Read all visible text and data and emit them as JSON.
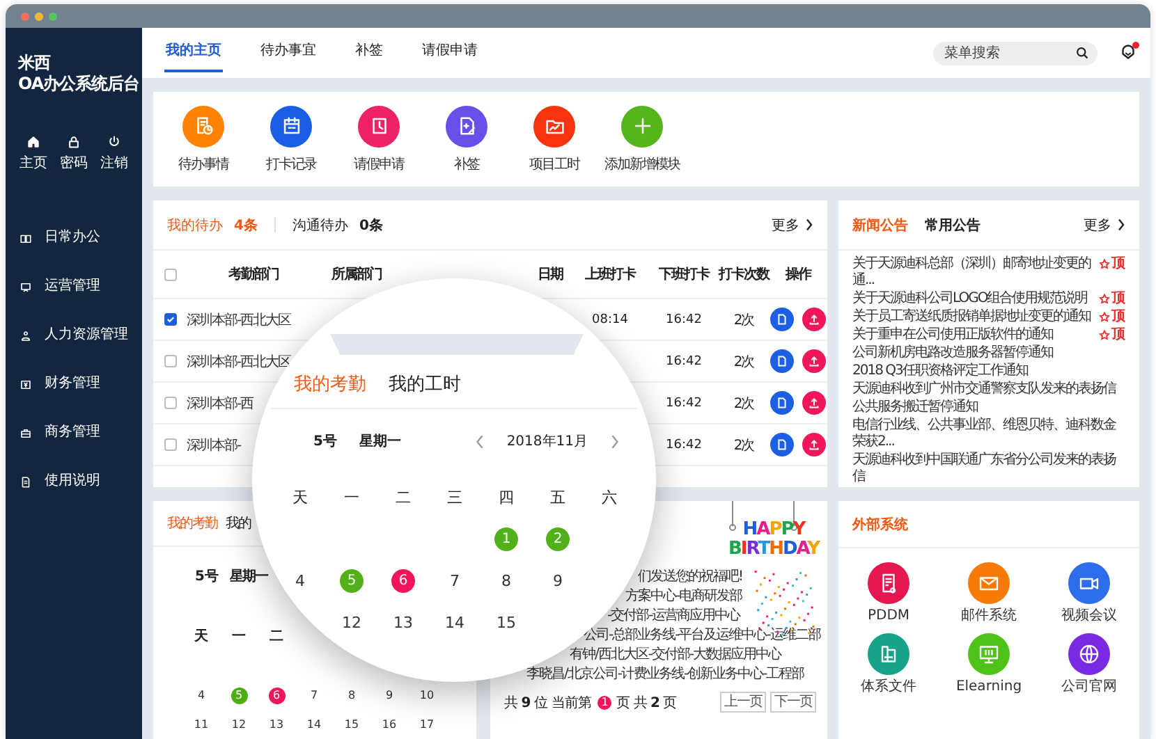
{
  "sidebar": {
    "title_lines": [
      "米西",
      "OA办公系统后台"
    ],
    "shortcuts": [
      {
        "label": "主页"
      },
      {
        "label": "密码"
      },
      {
        "label": "注销"
      }
    ],
    "menu": [
      {
        "label": "日常办公"
      },
      {
        "label": "运营管理"
      },
      {
        "label": "人力资源管理"
      },
      {
        "label": "财务管理"
      },
      {
        "label": "商务管理"
      },
      {
        "label": "使用说明"
      }
    ]
  },
  "header": {
    "tabs": [
      {
        "label": "我的主页",
        "selected": true
      },
      {
        "label": "待办事宜",
        "selected": false
      },
      {
        "label": "补签",
        "selected": false
      },
      {
        "label": "请假申请",
        "selected": false
      }
    ],
    "search": {
      "placeholder": "菜单搜索"
    },
    "notifications": {
      "unread": true
    }
  },
  "quick_actions": [
    {
      "label": "待办事情",
      "color": "#ff8200"
    },
    {
      "label": "打卡记录",
      "color": "#1a5ee6"
    },
    {
      "label": "请假申请",
      "color": "#ee2266"
    },
    {
      "label": "补签",
      "color": "#6a4ee8"
    },
    {
      "label": "项目工时",
      "color": "#f7340f"
    },
    {
      "label": "添加新增模块",
      "color": "#55b51c"
    }
  ],
  "todo": {
    "tabs": [
      {
        "label": "我的待办",
        "count": "4条",
        "selected": true
      },
      {
        "label": "沟通待办",
        "count": "0条",
        "selected": false
      }
    ],
    "more": "更多",
    "select_all": {
      "checked": false
    },
    "columns": [
      "考勤部门",
      "所属部门",
      "日期",
      "上班打卡",
      "下班打卡",
      "打卡次数",
      "操作"
    ],
    "rows": [
      {
        "checked": true,
        "dept": "深圳本部-西北大区",
        "clock_in": "08:14",
        "clock_out": "16:42",
        "count": "2次"
      },
      {
        "checked": false,
        "dept": "深圳本部-西北大区",
        "clock_out": "16:42",
        "count": "2次"
      },
      {
        "checked": false,
        "dept": "深圳本部-西",
        "clock_out": "16:42",
        "count": "2次"
      },
      {
        "checked": false,
        "dept": "深圳本部-",
        "clock_out": "16:42",
        "count": "2次"
      }
    ]
  },
  "news": {
    "tabs": [
      {
        "label": "新闻公告",
        "selected": true
      },
      {
        "label": "常用公告",
        "selected": false
      }
    ],
    "more": "更多",
    "items": [
      {
        "title": "关于天源迪科总部（深圳）邮寄地址变更的通...",
        "pinned": true,
        "pin_label": "顶"
      },
      {
        "title": "关于天源迪科公司LOGO组合使用规范说明",
        "pinned": true,
        "pin_label": "顶"
      },
      {
        "title": "关于员工寄送纸质报销单据地址变更的通知",
        "pinned": true,
        "pin_label": "顶"
      },
      {
        "title": "关于重申在公司使用正版软件的通知",
        "pinned": true,
        "pin_label": "顶"
      },
      {
        "title": "公司新机房电路改造服务器暂停通知",
        "pinned": false
      },
      {
        "title": "2018 Q3任职资格评定工作通知",
        "pinned": false
      },
      {
        "title": "天源迪科收到广州市交通警察支队发来的表扬信",
        "pinned": false
      },
      {
        "title": "公共服务搬迁暂停通知",
        "pinned": false
      },
      {
        "title": "电信行业线、公共事业部、维恩贝特、迪科数金荣获2...",
        "pinned": false
      },
      {
        "title": "天源迪科收到中国联通广东省分公司发来的表扬信",
        "pinned": false
      }
    ]
  },
  "attendance": {
    "tabs": [
      {
        "label": "我的考勤",
        "selected": true
      },
      {
        "label": "我的",
        "selected": false
      }
    ],
    "day": "5号",
    "weekday": "星期一",
    "weekdays": [
      "天",
      "一",
      "二"
    ],
    "weeks": [
      [
        {
          "day": "4"
        },
        {
          "day": "5",
          "color": "#4cae14"
        },
        {
          "day": "6",
          "color": "#f0165a"
        },
        {
          "day": "7"
        },
        {
          "day": "8"
        },
        {
          "day": "9"
        },
        {
          "day": "10"
        }
      ],
      [
        {
          "day": "11"
        },
        {
          "day": "12"
        },
        {
          "day": "13"
        },
        {
          "day": "14"
        },
        {
          "day": "15"
        },
        {
          "day": "16"
        },
        {
          "day": "17"
        }
      ]
    ]
  },
  "birthday": {
    "lines": [
      "们发送您的祝福吧!",
      "方案中心-电商研发部",
      "-交付部-运营商应用中心",
      "公司-总部业务线-平台及运维中心-运维二部",
      "有钟/西北大区-交付部-大数据应用中心",
      "李晓昌/北京公司-计费业务线-创新业务中心-工程部"
    ],
    "banner": [
      "HAPPY",
      "BIRTHDAY"
    ],
    "total": "共 **9** 位",
    "page_prefix": "当前第",
    "page": "1",
    "page_suffix": "页",
    "pages": "共 **2** 页",
    "buttons": [
      "上一页",
      "下一页"
    ]
  },
  "external": {
    "title": "外部系统",
    "items": [
      {
        "label": "PDDM",
        "color": "#e5174e"
      },
      {
        "label": "邮件系统",
        "color": "#f67a06"
      },
      {
        "label": "视频会议",
        "color": "#2d6cea"
      },
      {
        "label": "体系文件",
        "color": "#16a38a"
      },
      {
        "label": "Elearning",
        "color": "#4fc21a"
      },
      {
        "label": "公司官网",
        "color": "#7a2ae0"
      }
    ]
  },
  "magnifier": {
    "tabs": [
      {
        "label": "我的考勤",
        "selected": true
      },
      {
        "label": "我的工时",
        "selected": false
      }
    ],
    "day": "5号",
    "weekday": "星期一",
    "month": "2018年11月",
    "weekdays": [
      "天",
      "一",
      "二",
      "三",
      "四",
      "五",
      "六"
    ],
    "weeks": [
      [
        {
          "day": "1",
          "color": "#52b11a"
        },
        {
          "day": "2",
          "color": "#52b11a"
        }
      ],
      [
        {
          "day": "4"
        },
        {
          "day": "5",
          "color": "#52b11a"
        },
        {
          "day": "6",
          "color": "#f0165a"
        },
        {
          "day": "7"
        },
        {
          "day": "8"
        },
        {
          "day": "9"
        }
      ],
      [
        {
          "day": "12"
        },
        {
          "day": "13"
        },
        {
          "day": "14"
        },
        {
          "day": "15"
        }
      ]
    ]
  }
}
